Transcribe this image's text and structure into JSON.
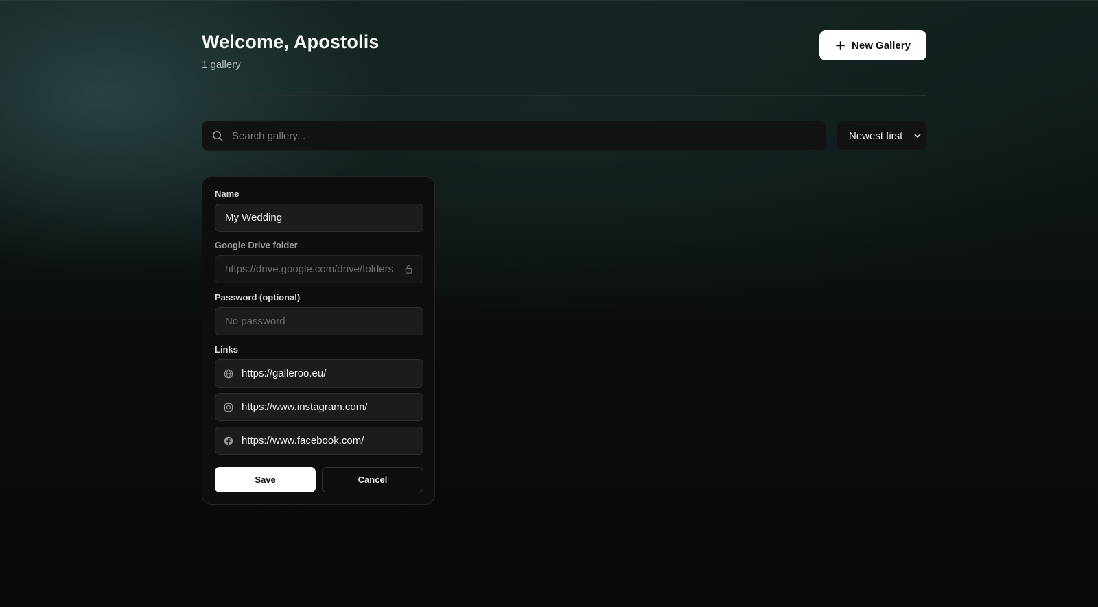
{
  "header": {
    "welcome": "Welcome, Apostolis",
    "gallery_count": "1 gallery",
    "new_gallery_label": "New Gallery"
  },
  "search": {
    "placeholder": "Search gallery...",
    "value": ""
  },
  "sort": {
    "selected": "Newest first"
  },
  "edit_form": {
    "name_label": "Name",
    "name_value": "My Wedding",
    "drive_label": "Google Drive folder",
    "drive_value": "https://drive.google.com/drive/folders",
    "password_label": "Password (optional)",
    "password_placeholder": "No password",
    "links_label": "Links",
    "links": [
      {
        "icon": "globe-icon",
        "url": "https://galleroo.eu/"
      },
      {
        "icon": "instagram-icon",
        "url": "https://www.instagram.com/"
      },
      {
        "icon": "facebook-icon",
        "url": "https://www.facebook.com/"
      }
    ],
    "save_label": "Save",
    "cancel_label": "Cancel"
  },
  "colors": {
    "accent": "#ffffff",
    "background": "#090909",
    "card": "#0e0e0e",
    "field": "#1c1c1c"
  }
}
